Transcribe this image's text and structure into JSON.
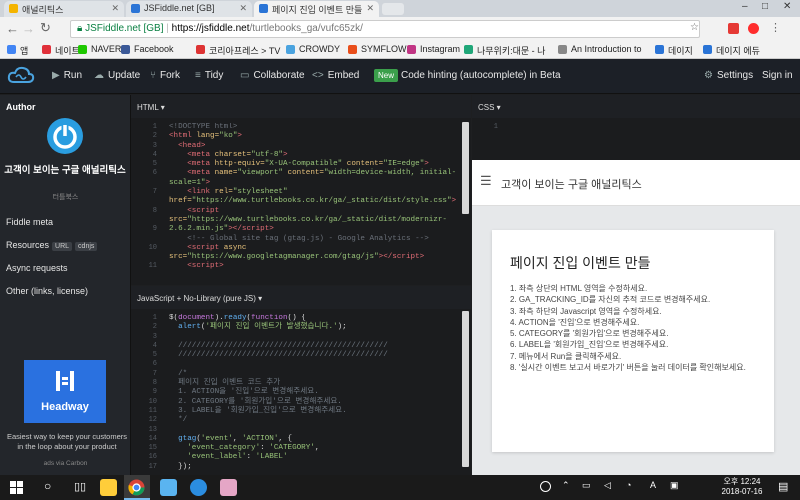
{
  "browser": {
    "tabs": [
      {
        "label": "애널리틱스",
        "active": false,
        "icon_color": "#f4b400"
      },
      {
        "label": "JSFiddle.net [GB]",
        "active": false,
        "icon_color": "#2a74d6"
      },
      {
        "label": "페이지 진입 이벤트 만들",
        "active": true,
        "icon_color": "#2a74d6"
      }
    ],
    "address": {
      "secure_label": "JSFiddle.net [GB]",
      "host": "https://jsfiddle.net",
      "path": "/turtlebooks_ga/vufc65zk/"
    },
    "bookmarks": [
      {
        "label": "앱",
        "color": "#4285f4"
      },
      {
        "label": "네이트",
        "color": "#e0303a"
      },
      {
        "label": "NAVER",
        "color": "#1ec800"
      },
      {
        "label": "Facebook",
        "color": "#3b5998"
      },
      {
        "label": "코리아프레스 > TV",
        "color": "#d33"
      },
      {
        "label": "CROWDY",
        "color": "#4aa3df"
      },
      {
        "label": "SYMFLOW",
        "color": "#e94e1b"
      },
      {
        "label": "Instagram",
        "color": "#c13584"
      },
      {
        "label": "나무위키:대문 - 나",
        "color": "#1fa678"
      },
      {
        "label": "An Introduction to",
        "color": "#888888"
      },
      {
        "label": "데이지",
        "color": "#2a74d6"
      },
      {
        "label": "데이지 에듀",
        "color": "#2a74d6"
      }
    ]
  },
  "toolbar": {
    "run": "Run",
    "update": "Update",
    "fork": "Fork",
    "tidy": "Tidy",
    "collaborate": "Collaborate",
    "embed": "Embed",
    "new_badge": "New",
    "announcement": "Code hinting (autocomplete) in Beta",
    "settings": "Settings",
    "signin": "Sign in"
  },
  "sidebar": {
    "author_label": "Author",
    "fiddle_title": "고객이 보이는 구글 애널리틱스",
    "fiddle_user": "터틀북스",
    "fiddle_meta": "Fiddle meta",
    "resources": "Resources",
    "url_chip": "URL",
    "cdnjs_chip": "cdnjs",
    "async_requests": "Async requests",
    "other": "Other (links, license)",
    "ad_brand": "Headway",
    "ad_text": "Easiest way to keep your customers in the loop about your product",
    "ad_via": "ads via Carbon"
  },
  "panels": {
    "html_label": "HTML ▾",
    "css_label": "CSS ▾",
    "js_label": "JavaScript + No-Library (pure JS) ▾"
  },
  "result": {
    "header_title": "고객이 보이는 구글 애널리틱스",
    "card_title": "페이지 진입 이벤트 만들",
    "steps": [
      "1. 좌측 상단의 HTML 영역을 수정하세요.",
      "2. GA_TRACKING_ID를 자신의 추적 코드로 변경해주세요.",
      "3. 좌측 하단의 Javascript 영역을 수정하세요.",
      "4. ACTION을 '진입'으로 변경해주세요.",
      "5. CATEGORY를 '회원가입'으로 변경해주세요.",
      "6. LABEL을 '회원가입_진입'으로 변경해주세요.",
      "7. 메뉴에서 Run을 클릭해주세요.",
      "8. '실시간 이벤트 보고서 바로가기' 버튼을 눌러 데이터를 확인해보세요."
    ]
  },
  "taskbar": {
    "time": "오후 12:24",
    "date": "2018-07-16"
  }
}
